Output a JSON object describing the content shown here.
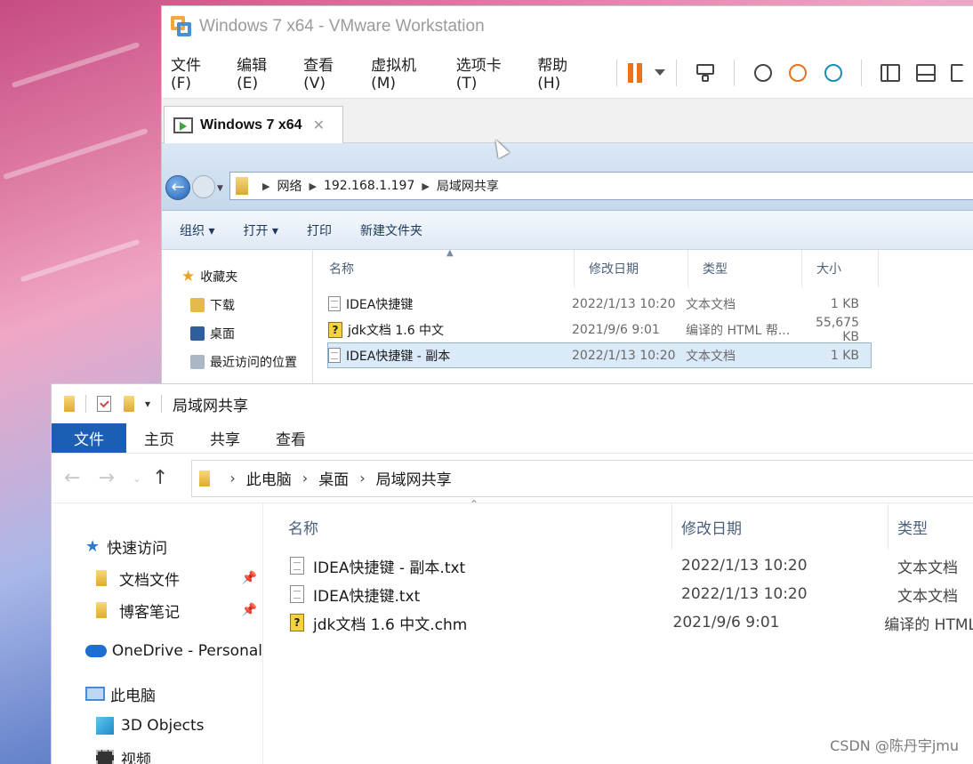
{
  "vmware": {
    "title": "Windows 7 x64 - VMware Workstation",
    "menus": [
      "文件(F)",
      "编辑(E)",
      "查看(V)",
      "虚拟机(M)",
      "选项卡(T)",
      "帮助(H)"
    ],
    "tab_label": "Windows 7 x64",
    "tab_close": "✕"
  },
  "guest": {
    "back_glyph": "←",
    "breadcrumb": [
      "网络",
      "192.168.1.197",
      "局域网共享"
    ],
    "commands": [
      "组织 ▾",
      "打开 ▾",
      "打印",
      "新建文件夹"
    ],
    "nav": [
      "收藏夹",
      "下载",
      "桌面",
      "最近访问的位置"
    ],
    "columns": [
      "名称",
      "修改日期",
      "类型",
      "大小"
    ],
    "rows": [
      {
        "name": "IDEA快捷键",
        "date": "2022/1/13 10:20",
        "type": "文本文档",
        "size": "1 KB"
      },
      {
        "name": "jdk文档 1.6 中文",
        "date": "2021/9/6 9:01",
        "type": "编译的 HTML 帮...",
        "size": "55,675 KB"
      },
      {
        "name": "IDEA快捷键 - 副本",
        "date": "2022/1/13 10:20",
        "type": "文本文档",
        "size": "1 KB"
      }
    ]
  },
  "explorer": {
    "title": "局域网共享",
    "tabs": [
      "文件",
      "主页",
      "共享",
      "查看"
    ],
    "breadcrumb": [
      "此电脑",
      "桌面",
      "局域网共享"
    ],
    "nav": [
      "快速访问",
      "文档文件",
      "博客笔记",
      "OneDrive - Personal",
      "此电脑",
      "3D Objects",
      "视频"
    ],
    "columns": [
      "名称",
      "修改日期",
      "类型"
    ],
    "rows": [
      {
        "name": "IDEA快捷键 - 副本.txt",
        "date": "2022/1/13 10:20",
        "type": "文本文档"
      },
      {
        "name": "IDEA快捷键.txt",
        "date": "2022/1/13 10:20",
        "type": "文本文档"
      },
      {
        "name": "jdk文档 1.6 中文.chm",
        "date": "2021/9/6 9:01",
        "type": "编译的 HTML"
      }
    ]
  },
  "watermark": "CSDN @陈丹宇jmu",
  "colors": {
    "accent": "#1a5fb4",
    "selection": "#dbeaf9",
    "pause": "#e8731c"
  }
}
